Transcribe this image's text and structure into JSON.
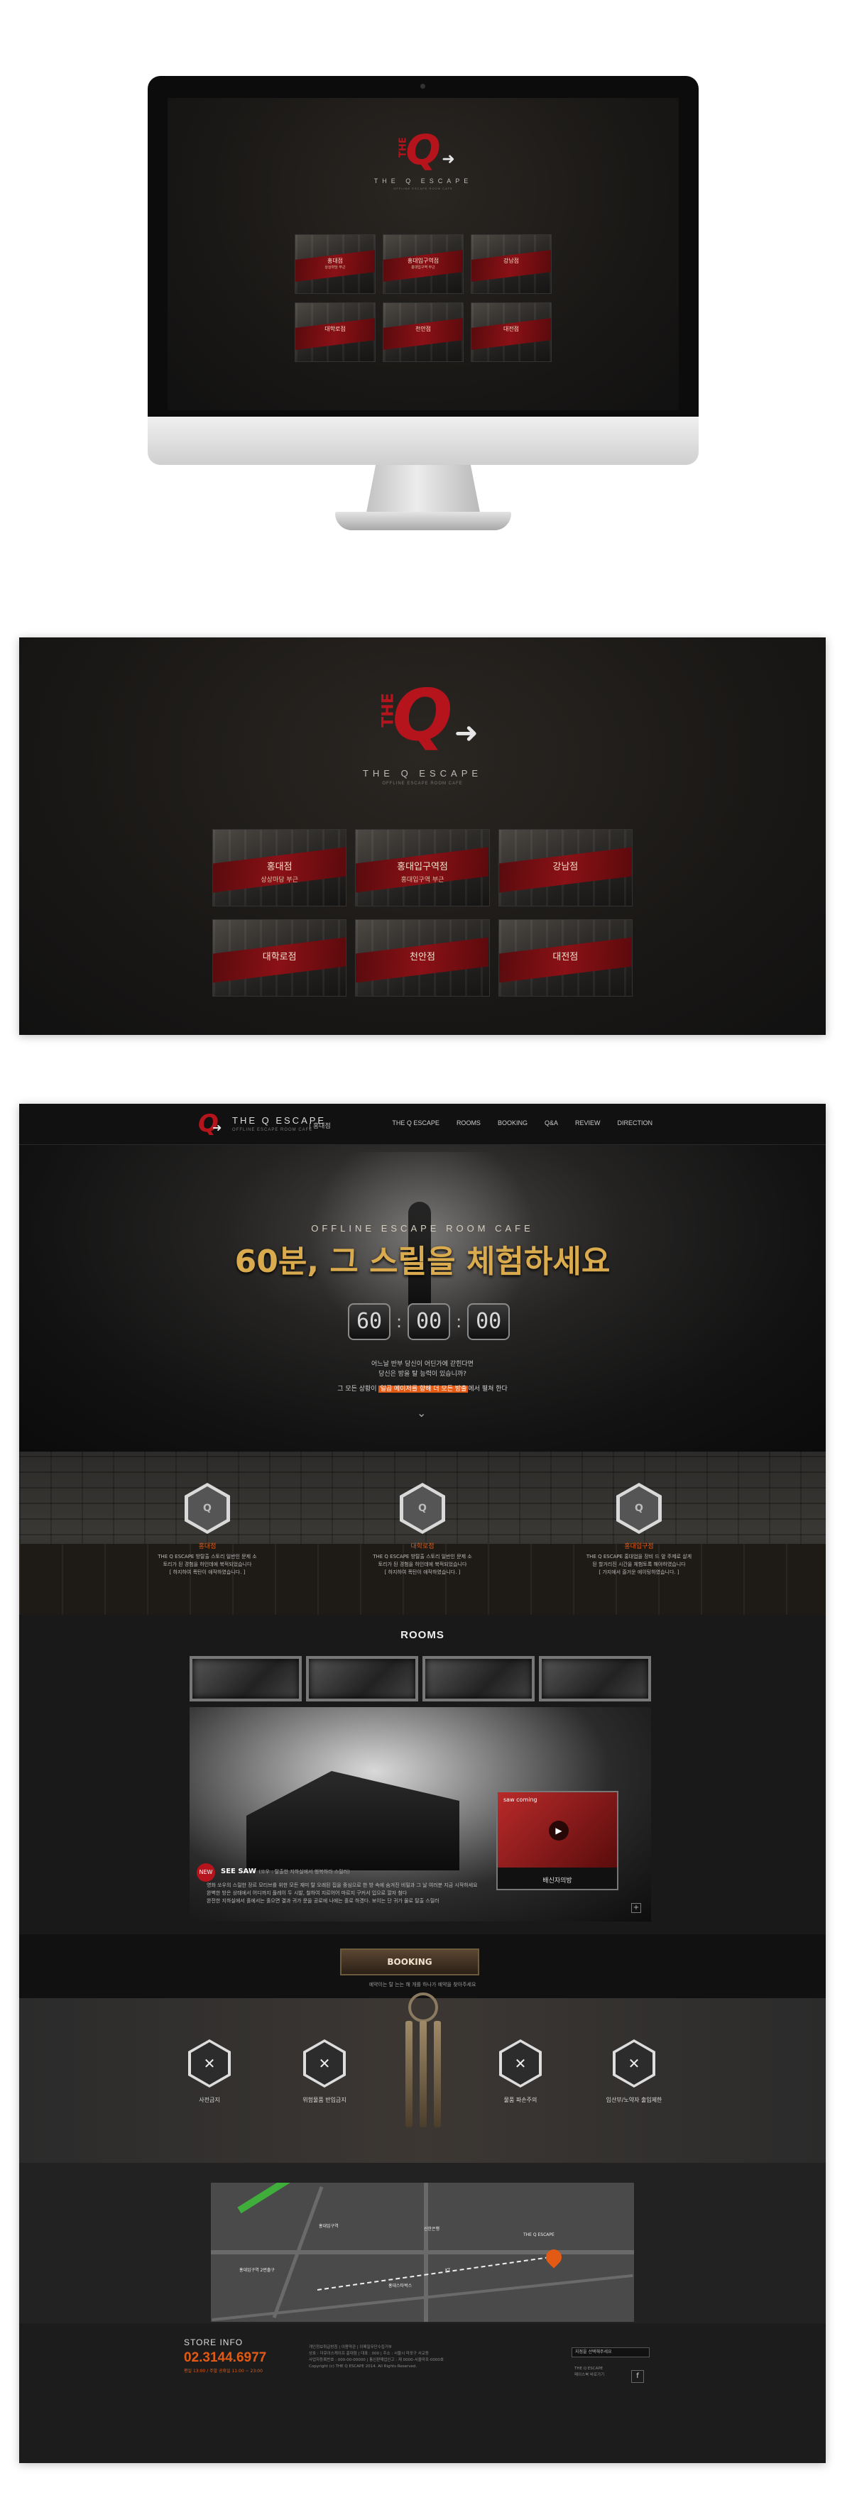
{
  "brand": {
    "logo_q": "Q",
    "logo_the": "THE",
    "logo_arrow": "➜",
    "name": "THE Q ESCAPE",
    "subtitle": "OFFLINE ESCAPE ROOM CAFE"
  },
  "stores": [
    {
      "name": "홍대점",
      "sub": "상상마당 부근"
    },
    {
      "name": "홍대입구역점",
      "sub": "홍대입구역 부근"
    },
    {
      "name": "강남점",
      "sub": ""
    },
    {
      "name": "대학로점",
      "sub": ""
    },
    {
      "name": "천안점",
      "sub": ""
    },
    {
      "name": "대전점",
      "sub": ""
    }
  ],
  "header": {
    "store": "| 홍대점",
    "nav": [
      "THE Q ESCAPE",
      "ROOMS",
      "BOOKING",
      "Q&A",
      "REVIEW",
      "DIRECTION"
    ]
  },
  "hero": {
    "sub": "OFFLINE ESCAPE ROOM CAFE",
    "headline": "60분, 그 스릴을 체험하세요",
    "timer": [
      "60",
      "00",
      "00"
    ],
    "p1_line1": "어느날 반부 당신이 어딘가에 갇힌다면",
    "p1_line2": "당신은 방을 탈 능력이 있습니까?",
    "p2_before": "그 모든 상황이 ",
    "p2_highlight": "일곱 메이저를 향해 더 모든 방출",
    "p2_after": "에서 펼쳐 한다",
    "chevron": "⌄"
  },
  "features": [
    {
      "icon": "Q",
      "title": "홍대점",
      "desc_1": "THE Q ESCAPE 방탈출 스토리 일반인 문제 소",
      "desc_2": "토리가 된 경험을 하인데에 북적되었습니다",
      "desc_3": "[ 하지하여 폭탄이 애작하였습니다. ]"
    },
    {
      "icon": "Q",
      "title": "대학로점",
      "desc_1": "THE Q ESCAPE 방탈출 스토리 일반인 문제 소",
      "desc_2": "토리가 된 경험을 하인데에 북적되었습니다",
      "desc_3": "[ 하지하여 폭탄이 애작하였습니다. ]"
    },
    {
      "icon": "Q",
      "title": "홍대입구점",
      "desc_1": "THE Q ESCAPE 홍대업을 장비 드 앞 주제로 살게",
      "desc_2": "된 할거리진 시간을 체험토록 해야하였습니다",
      "desc_3": "[ 가지에서 즐거운 에이팅하였습니다. ]"
    }
  ],
  "rooms": {
    "title": "ROOMS",
    "badge": "NEW",
    "room_title": "SEE SAW",
    "room_meta": "(쏘우 : 탈출한 지하실에서 행복하라 스릴러)",
    "desc_1": "영화 쏘우의 스릴한 장르 모티브를 위한 모든 재미 탈 오래된 집을 중심으로 한 방 속에 숨겨진 비밀과 그 날 여러분 지금 시작하세요",
    "desc_2": "완벽한 방은 상태에서 어디까지 플레이 두 시발, 철하여 지르어어 마르지 구커서 입으로 깔자 첨다",
    "desc_3": "완전한 지하실에서 홀에서는 홀으면 결과 귀가 문을 공로에 나에는 홀로 하겠다. 보이는 단 귀가 물로 탈출 스릴러",
    "video_label": "saw coming",
    "video_caption": "배신자의방",
    "more": "+"
  },
  "booking": {
    "label": "BOOKING",
    "note": "예약이는 탈 는는 해 개를 하나가 예약을 찾아주세요"
  },
  "rules": [
    {
      "icon": "✕",
      "label": "사전금지"
    },
    {
      "icon": "✕",
      "label": "위험물품 반입금지"
    },
    {
      "icon": "✕",
      "label": "물품 파손주의"
    },
    {
      "icon": "✕",
      "label": "임산부/노약자 출입제한"
    }
  ],
  "map": {
    "labels": [
      "홍대입구역",
      "홍대입구역 2번출구",
      "신한은행",
      "KT",
      "홍대스타벅스",
      "THE Q ESCAPE"
    ]
  },
  "footer": {
    "store_info": "STORE INFO",
    "phone": "02.3144.6977",
    "hours": "평일 13:00 / 주말 공휴일 11:00 ~ 23:00",
    "info_1": "개인정보취급방침 | 이용약관 | 이메일무단수집거부",
    "info_2": "상호 : 더큐이스케이프 홍대점 | 대표 : 000 | 주소 : 서울시 마포구 서교동",
    "info_3": "사업자등록번호 : 000-00-00000 | 통신판매업신고 : 제 0000-서울마포-0000호",
    "info_4": "Copyright (c) THE Q ESCAPE 2014. All Rights Reserved.",
    "select": "지점을 선택해주세요",
    "family_1": "THE Q ESCAPE",
    "family_2": "페이스북 바로가기",
    "fb": "f"
  },
  "colors": {
    "accent": "#e35a14",
    "brand_red": "#b5141c",
    "gold": "#d9ab4e"
  }
}
